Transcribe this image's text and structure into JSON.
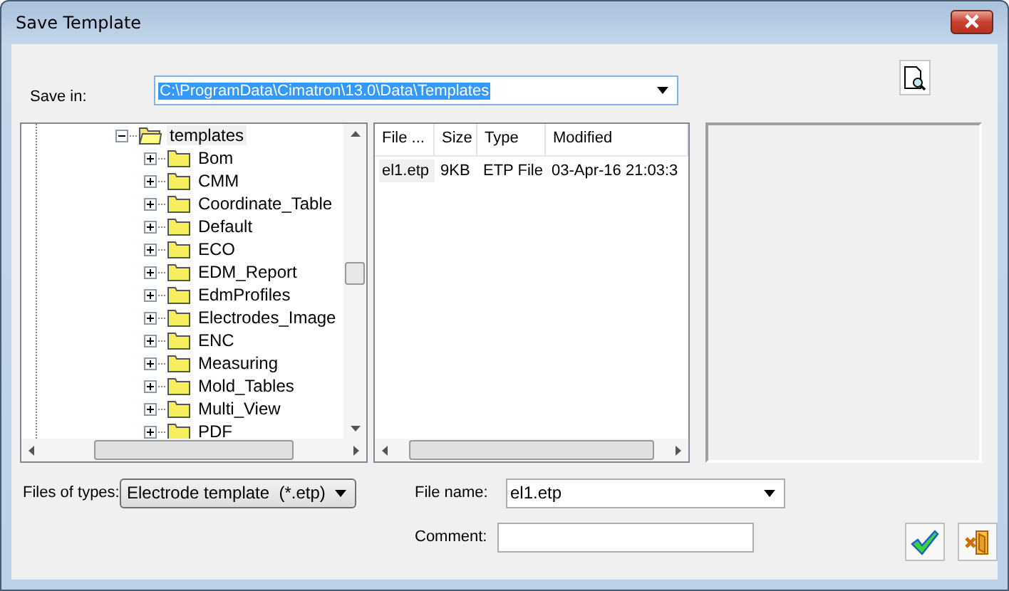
{
  "window": {
    "title": "Save Template"
  },
  "save_in": {
    "label": "Save in:",
    "value": "C:\\ProgramData\\Cimatron\\13.0\\Data\\Templates",
    "selected": true
  },
  "tree": {
    "items": [
      {
        "label": "templates",
        "expanded": true,
        "selected": true,
        "children": [
          {
            "label": "Bom",
            "expanded": false
          },
          {
            "label": "CMM",
            "expanded": false
          },
          {
            "label": "Coordinate_Table",
            "expanded": false
          },
          {
            "label": "Default",
            "expanded": false
          },
          {
            "label": "ECO",
            "expanded": false
          },
          {
            "label": "EDM_Report",
            "expanded": false
          },
          {
            "label": "EdmProfiles",
            "expanded": false
          },
          {
            "label": "Electrodes_Image",
            "expanded": false
          },
          {
            "label": "ENC",
            "expanded": false
          },
          {
            "label": "Measuring",
            "expanded": false
          },
          {
            "label": "Mold_Tables",
            "expanded": false
          },
          {
            "label": "Multi_View",
            "expanded": false
          },
          {
            "label": "PDF",
            "expanded": false
          }
        ]
      }
    ]
  },
  "file_list": {
    "columns": [
      "File ...",
      "Size",
      "Type",
      "Modified"
    ],
    "rows": [
      {
        "cells": [
          "el1.etp",
          "9KB",
          "ETP File",
          "03-Apr-16 21:03:3"
        ],
        "selected": true
      }
    ]
  },
  "files_of_types": {
    "label": "Files of types:",
    "value": "Electrode template  (*.etp)"
  },
  "file_name": {
    "label": "File name:",
    "value": "el1.etp"
  },
  "comment": {
    "label": "Comment:"
  }
}
